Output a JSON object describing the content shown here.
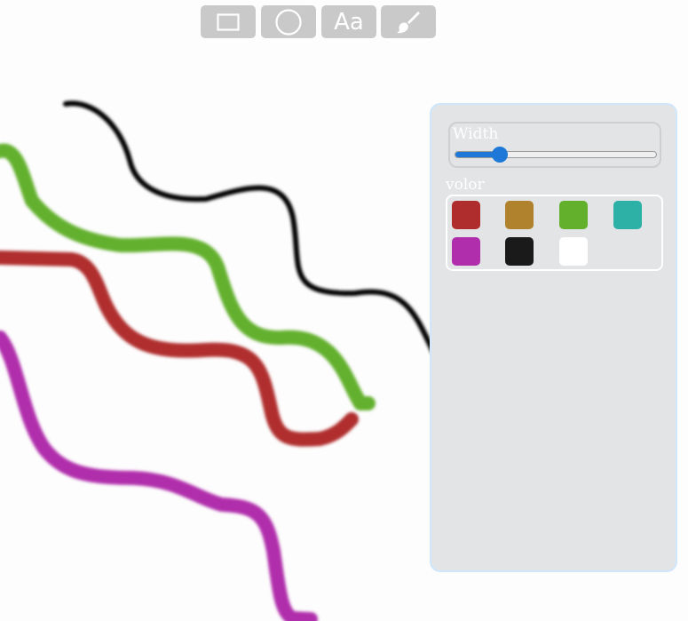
{
  "toolbar": {
    "tools": [
      {
        "name": "rectangle-tool",
        "icon": "rectangle-icon"
      },
      {
        "name": "circle-tool",
        "icon": "circle-icon"
      },
      {
        "name": "text-tool",
        "icon": "text-icon",
        "label": "Aa"
      },
      {
        "name": "brush-tool",
        "icon": "brush-icon"
      }
    ]
  },
  "panel": {
    "width_label": "Width",
    "width_value": 0.22,
    "color_label": "volor",
    "colors": [
      "#b02d2d",
      "#b0822d",
      "#63b02d",
      "#2db0a6",
      "#b02dab",
      "#1a1a1a",
      "#ffffff"
    ]
  },
  "strokes": [
    {
      "name": "black-stroke",
      "color": "#000000"
    },
    {
      "name": "green-stroke",
      "color": "#63b02d"
    },
    {
      "name": "red-stroke",
      "color": "#b02d2d"
    },
    {
      "name": "magenta-stroke",
      "color": "#b02dab"
    }
  ]
}
